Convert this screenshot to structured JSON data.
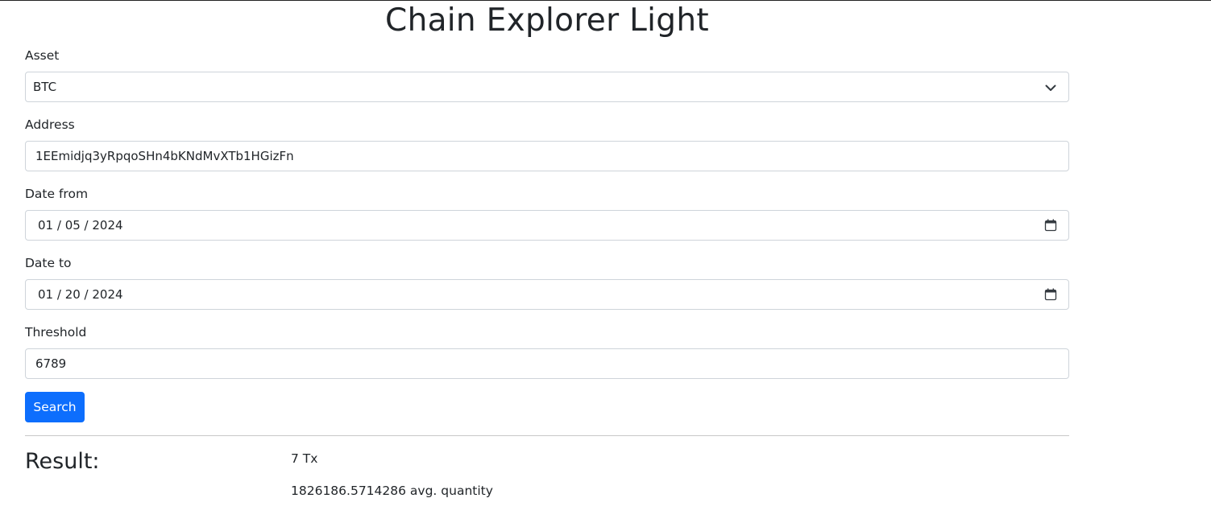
{
  "page": {
    "title": "Chain Explorer Light"
  },
  "form": {
    "asset": {
      "label": "Asset",
      "selected": "BTC"
    },
    "address": {
      "label": "Address",
      "value": "1EEmidjq3yRpqoSHn4bKNdMvXTb1HGizFn"
    },
    "date_from": {
      "label": "Date from",
      "month": "01",
      "day": "05",
      "year": "2024"
    },
    "date_to": {
      "label": "Date to",
      "month": "01",
      "day": "20",
      "year": "2024"
    },
    "threshold": {
      "label": "Threshold",
      "value": "6789"
    },
    "search_label": "Search"
  },
  "result": {
    "heading": "Result:",
    "tx_count": "7 Tx",
    "avg_quantity": "1826186.5714286 avg. quantity"
  },
  "icons": {
    "select": "chevron-down-icon",
    "date": "calendar-icon"
  },
  "colors": {
    "primary": "#0d6efd",
    "text": "#212529",
    "border": "#ced4da"
  }
}
